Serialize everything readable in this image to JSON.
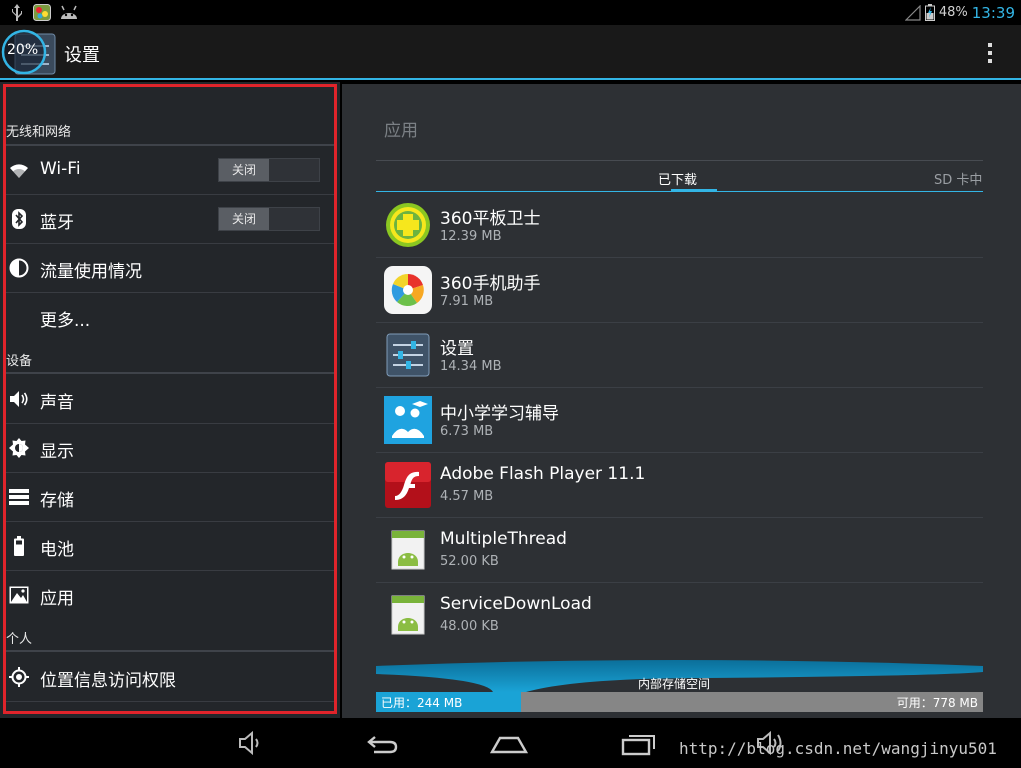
{
  "status_bar": {
    "battery": "48%",
    "time": "13:39",
    "icons_left": [
      "usb-icon",
      "app-notification-icon",
      "android-debug-icon"
    ],
    "accent": "#33b5e5"
  },
  "action_bar": {
    "title": "设置",
    "overlay_badge": "20%"
  },
  "left_pane": {
    "sections": [
      {
        "header": "无线和网络",
        "items": [
          {
            "label": "Wi-Fi",
            "icon": "wifi-icon",
            "toggle": "关闭"
          },
          {
            "label": "蓝牙",
            "icon": "bluetooth-icon",
            "toggle": "关闭"
          },
          {
            "label": "流量使用情况",
            "icon": "data-usage-icon"
          },
          {
            "label": "更多...",
            "icon": ""
          }
        ]
      },
      {
        "header": "设备",
        "items": [
          {
            "label": "声音",
            "icon": "sound-icon"
          },
          {
            "label": "显示",
            "icon": "display-icon"
          },
          {
            "label": "存储",
            "icon": "storage-icon"
          },
          {
            "label": "电池",
            "icon": "battery-icon"
          },
          {
            "label": "应用",
            "icon": "apps-icon"
          }
        ]
      },
      {
        "header": "个人",
        "items": [
          {
            "label": "位置信息访问权限",
            "icon": "location-icon"
          }
        ]
      }
    ],
    "highlight_color": "#e0242b"
  },
  "right_pane": {
    "title": "应用",
    "tabs": [
      {
        "label": "已下载",
        "selected": true
      },
      {
        "label": "SD 卡中",
        "selected": false
      }
    ],
    "apps": [
      {
        "name": "360平板卫士",
        "size": "12.39 MB",
        "icon": "360-security-icon"
      },
      {
        "name": "360手机助手",
        "size": "7.91 MB",
        "icon": "360-assistant-icon"
      },
      {
        "name": "设置",
        "size": "14.34 MB",
        "icon": "settings-app-icon"
      },
      {
        "name": "中小学学习辅导",
        "size": "6.73 MB",
        "icon": "study-tutor-icon"
      },
      {
        "name": "Adobe Flash Player 11.1",
        "size": "4.57 MB",
        "icon": "flash-player-icon"
      },
      {
        "name": "MultipleThread",
        "size": "52.00 KB",
        "icon": "android-default-icon"
      },
      {
        "name": "ServiceDownLoad",
        "size": "48.00 KB",
        "icon": "android-default-icon"
      }
    ],
    "storage": {
      "label": "内部存储空间",
      "used": "已用：244 MB",
      "free": "可用：778 MB",
      "used_fraction": 0.239
    }
  },
  "nav_bar": {
    "buttons": [
      "volume-down-icon",
      "back-icon",
      "home-icon",
      "recent-apps-icon",
      "volume-up-icon"
    ]
  },
  "watermark": "http://blog.csdn.net/wangjinyu501"
}
